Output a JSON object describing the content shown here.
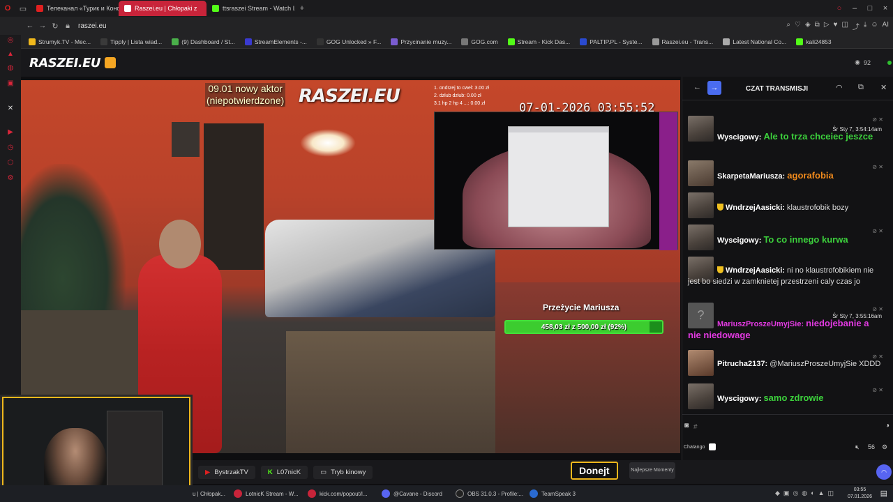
{
  "browser": {
    "tabs": [
      {
        "label": "Телеканал «Турик и Конс",
        "active": false,
        "color": "#e02020"
      },
      {
        "label": "Raszei.eu | Chłopaki z",
        "active": true,
        "color": "#ffffff"
      },
      {
        "label": "ttsraszei Stream - Watch L",
        "active": false,
        "color": "#53fc18"
      }
    ],
    "address": "raszei.eu",
    "bookmarks": [
      {
        "label": "Strumyk.TV - Mec...",
        "color": "#f0b81c"
      },
      {
        "label": "Tipply | Lista wiad...",
        "color": "#3a3a3a"
      },
      {
        "label": "(9) Dashboard / St...",
        "color": "#4ab04a"
      },
      {
        "label": "StreamElements -...",
        "color": "#3a3ad0"
      },
      {
        "label": "GOG Unlocked » F...",
        "color": "#333333"
      },
      {
        "label": "Przycinanie muzy...",
        "color": "#7a5cd0"
      },
      {
        "label": "GOG.com",
        "color": "#777777"
      },
      {
        "label": "Stream - Kick Das...",
        "color": "#53fc18"
      },
      {
        "label": "PALTIP.PL - Syste...",
        "color": "#2a4ad0"
      },
      {
        "label": "Raszei.eu - Trans...",
        "color": "#999999"
      },
      {
        "label": "Latest National Co...",
        "color": "#aaaaaa"
      },
      {
        "label": "kali24853",
        "color": "#53fc18"
      }
    ]
  },
  "site": {
    "logo": "RASZEI.EU",
    "viewers": "92"
  },
  "video": {
    "overlay_title_line1": "09.01 nowy aktor",
    "overlay_title_line2": "(niepotwierdzone)",
    "overlay_logo": "RASZEI.EU",
    "donors": [
      "1. ondrzej to cwel: 3.00 zł",
      "2. dzłub dzłub: 0.00 zł",
      "3.1 hp 2 hp 4 ...: 0.00 zł"
    ],
    "timestamp": "07-01-2026 03:55:52",
    "goal_title": "Przeżycie Mariusza",
    "goal_text": "458,03 zł z 500,00 zł (92%)",
    "goal_fraction": 0.92
  },
  "bottom": {
    "buttons": [
      {
        "label": "BystrzakTV",
        "icon": "youtube-icon",
        "color": "#e02020"
      },
      {
        "label": "L07nicK",
        "icon": "kick-icon",
        "color": "#53fc18"
      },
      {
        "label": "Tryb kinowy",
        "icon": "cinema-icon",
        "color": "#cccccc"
      }
    ],
    "donate": "Donejt",
    "best": "Najlepsze Momenty"
  },
  "chat": {
    "title": "CZAT TRANSMISJI",
    "messages": [
      {
        "author": "Wyscigowy",
        "text": "Ale to trza chceiec jeszce",
        "time": "Śr Sty 7, 3:54:14am",
        "style": "green"
      },
      {
        "author": "SkarpetaMariusza",
        "text": "agorafobia",
        "time": "",
        "style": "orange"
      },
      {
        "author": "WndrzejAasicki",
        "text": "klaustrofobik bozy",
        "time": "",
        "style": "plain"
      },
      {
        "author": "Wyscigowy",
        "text": "To co innego kurwa",
        "time": "",
        "style": "green"
      },
      {
        "author": "WndrzejAasicki",
        "text": "ni no klaustrofobikiem nie jest bo siedzi w zamknietej przestrzeni caly czas jo",
        "time": "",
        "style": "plain"
      },
      {
        "author": "MariuszProszeUmyjSie",
        "text": "niedojebanie a nie niedowage",
        "time": "Śr Sty 7, 3:55:16am",
        "style": "magenta"
      },
      {
        "author": "Pitrucha2137",
        "text": "@MariuszProszeUmyjSie XDDD",
        "time": "",
        "style": "plain"
      },
      {
        "author": "Wyscigowy",
        "text": "samo zdrowie",
        "time": "",
        "style": "green"
      }
    ],
    "input_placeholder": "#",
    "footer_label": "Chatango",
    "volume": "56"
  },
  "taskbar": {
    "items": [
      {
        "label": "u | Chłopak...",
        "color": "#c8243a"
      },
      {
        "label": "LotnicK Stream - W...",
        "color": "#c8243a"
      },
      {
        "label": "kick.com/popout/l...",
        "color": "#c8243a"
      },
      {
        "label": "@Cavane - Discord",
        "color": "#5865f2"
      },
      {
        "label": "OBS 31.0.3 - Profile:...",
        "color": "#222222"
      },
      {
        "label": "TeamSpeak 3",
        "color": "#2a6ad0"
      }
    ],
    "time": "03:55",
    "date": "07.01.2026"
  }
}
